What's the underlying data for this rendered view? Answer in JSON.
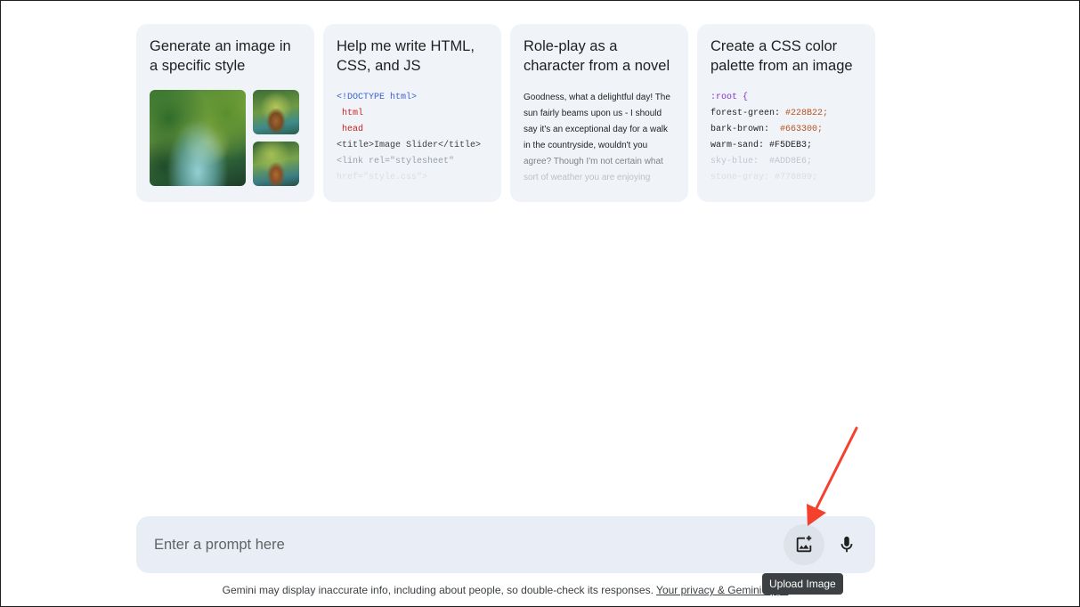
{
  "cards": [
    {
      "title": "Generate an image in a specific style"
    },
    {
      "title": "Help me write HTML, CSS, and JS",
      "code_lines": [
        "<!DOCTYPE html>",
        " html",
        " head",
        "<title>Image Slider</title>",
        "<link rel=\"stylesheet\"",
        "href=\"style.css\">"
      ]
    },
    {
      "title": "Role-play as a character from a novel",
      "lines": [
        "Goodness, what a delightful day! The",
        "sun fairly beams upon us - I should",
        "say it's an exceptional day for a walk",
        "in the countryside, wouldn't you",
        "agree? Though I'm not certain what",
        "sort of weather you are enjoying"
      ]
    },
    {
      "title": "Create a CSS color palette from an image",
      "code": {
        "root": ":root {",
        "vars": [
          {
            "name": "forest-green:",
            "value": "#228B22;"
          },
          {
            "name": "bark-brown:",
            "value": "#663300;"
          },
          {
            "name": "warm-sand:",
            "value": "#F5DEB3;"
          },
          {
            "name": "sky-blue:",
            "value": "#ADD8E6;"
          },
          {
            "name": "stone-gray:",
            "value": "#778899;"
          }
        ]
      }
    }
  ],
  "prompt": {
    "placeholder": "Enter a prompt here",
    "upload_icon": "add-photo-icon",
    "mic_icon": "mic-icon"
  },
  "tooltip": "Upload Image",
  "disclaimer": {
    "text": "Gemini may display inaccurate info, including about people, so double-check its responses.",
    "link": "Your privacy & Gemini Apps"
  },
  "annotation": {
    "arrow_color": "#f4402c"
  }
}
